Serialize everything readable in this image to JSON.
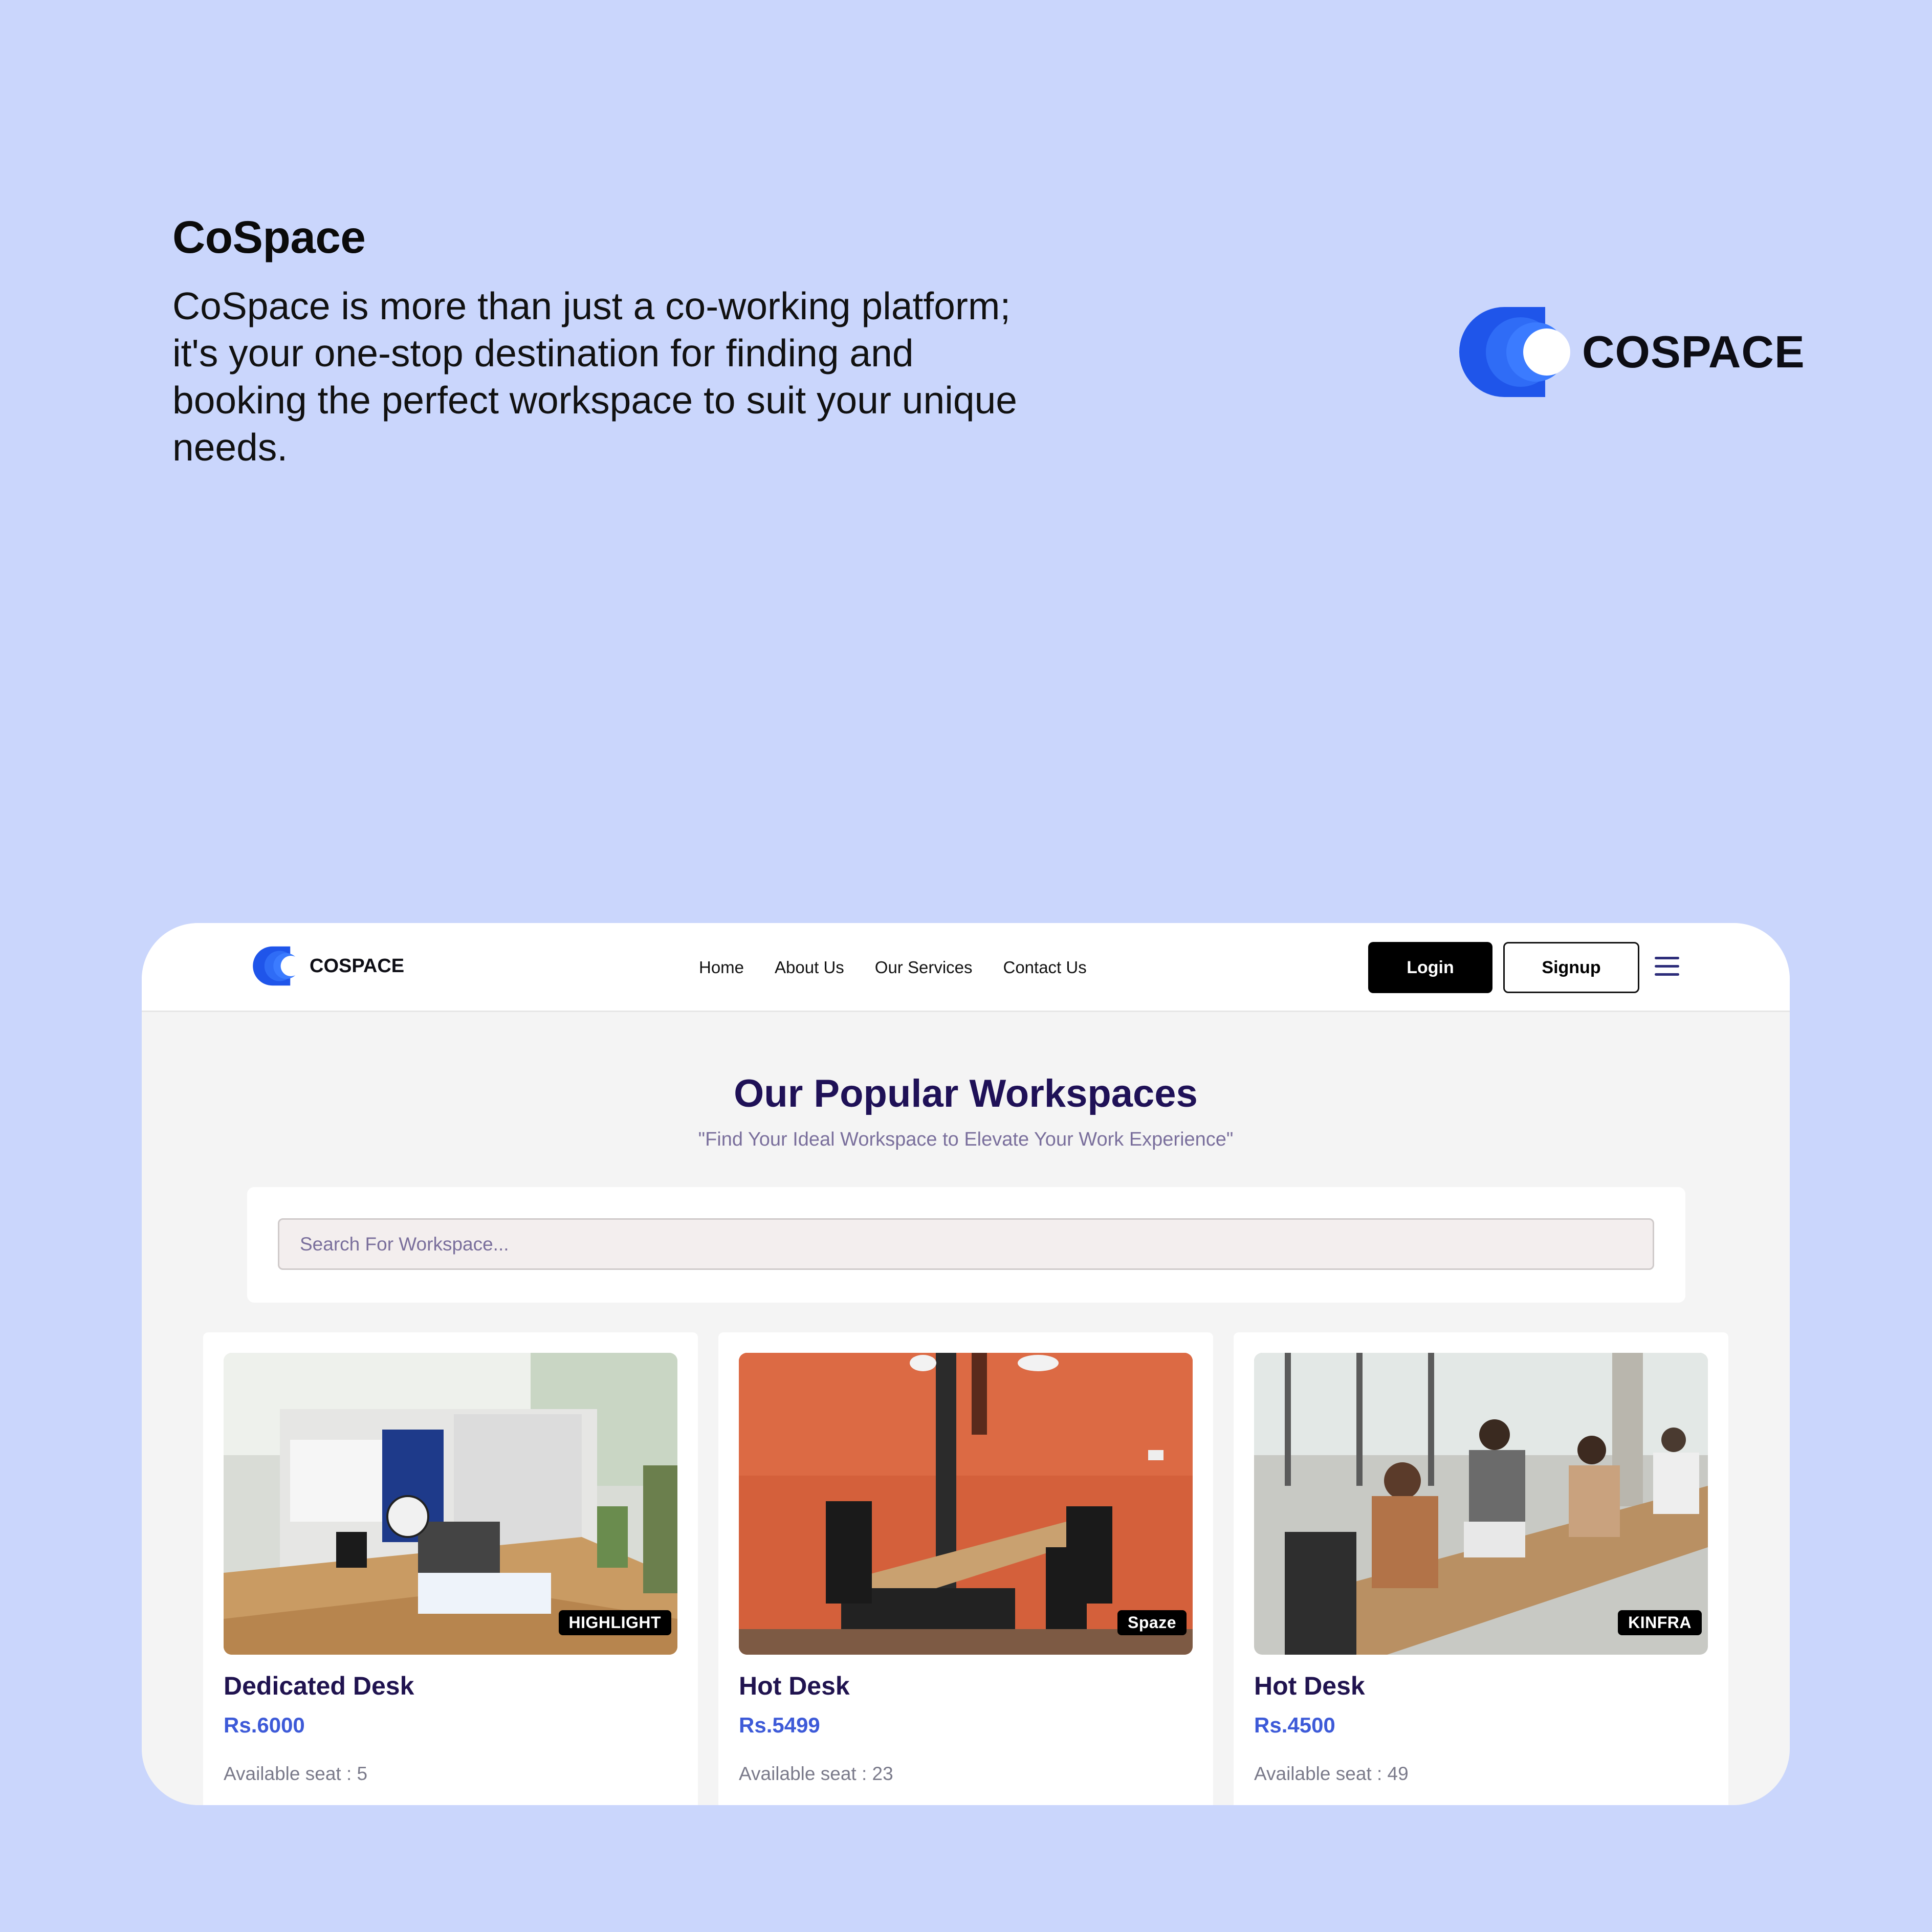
{
  "intro": {
    "title": "CoSpace",
    "description": "CoSpace is more than just a co-working platform; it's your one-stop destination for finding and booking the perfect workspace to suit your unique needs."
  },
  "brand": {
    "wordmark": "COSPACE",
    "colors": {
      "primary": "#1f55ea",
      "light": "#3b7bff"
    }
  },
  "nav": {
    "links": [
      "Home",
      "About Us",
      "Our Services",
      "Contact Us"
    ],
    "login_label": "Login",
    "signup_label": "Signup",
    "menu_icon": "hamburger-menu-icon"
  },
  "section": {
    "title": "Our Popular Workspaces",
    "subtitle": "\"Find Your Ideal Workspace to Elevate Your Work Experience\""
  },
  "search": {
    "placeholder": "Search For Workspace...",
    "value": ""
  },
  "cards": [
    {
      "title": "Dedicated Desk",
      "price": "Rs.6000",
      "seats": "Available seat : 5",
      "tag": "HIGHLIGHT"
    },
    {
      "title": "Hot Desk",
      "price": "Rs.5499",
      "seats": "Available seat : 23",
      "tag": "Spaze"
    },
    {
      "title": "Hot Desk",
      "price": "Rs.4500",
      "seats": "Available seat : 49",
      "tag": "KINFRA"
    }
  ],
  "colors": {
    "page_background": "#cad6fc",
    "heading": "#1f1157",
    "price": "#3d5ad8",
    "muted": "#7a6f9c"
  }
}
